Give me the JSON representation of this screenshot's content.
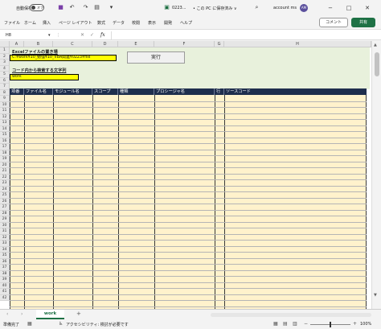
{
  "titlebar": {
    "autosave_label": "自動保存",
    "autosave_state": "オフ",
    "doc_name": "0223...",
    "save_status": "• この PC に保存済み ∨",
    "account_name": "account ms",
    "avatar_initials": "AM"
  },
  "menu": {
    "items": [
      "ファイル",
      "ホーム",
      "挿入",
      "ページ レイアウト",
      "数式",
      "データ",
      "校閲",
      "表示",
      "開発",
      "ヘルプ"
    ],
    "comment_label": "コメント",
    "share_label": "共有"
  },
  "formula_bar": {
    "name_box": "H8",
    "fx_label": "fx",
    "value": ""
  },
  "grid": {
    "columns": [
      "A",
      "B",
      "C",
      "D",
      "E",
      "F",
      "G",
      "H"
    ],
    "rows": [
      "1",
      "2",
      "3",
      "4",
      "5",
      "6",
      "7",
      "8",
      "9",
      "10",
      "11",
      "12",
      "13",
      "14",
      "15",
      "16",
      "17",
      "18",
      "19",
      "20",
      "21",
      "22",
      "23",
      "24",
      "25",
      "26",
      "27",
      "28",
      "29",
      "30",
      "31",
      "32",
      "33",
      "34",
      "35",
      "36",
      "37",
      "38",
      "39",
      "40",
      "41",
      "42"
    ]
  },
  "form": {
    "path_label": "Excelファイルの置き場",
    "path_value": "C:¥work¥10_勉強¥10_VBA関連¥0223¥file",
    "run_button": "実行",
    "search_label": "コード内から検索する文字列",
    "search_value": "work"
  },
  "result_table": {
    "headers": [
      "項番",
      "ファイル名",
      "モジュール名",
      "スコープ",
      "種類",
      "プロシージャ名",
      "行",
      "ソースコード"
    ]
  },
  "sheet_tabs": {
    "active": "work",
    "add_label": "+"
  },
  "statusbar": {
    "ready": "準備完了",
    "accessibility": "アクセシビリティ: 検討が必要です",
    "zoom_level": "100%"
  },
  "colors": {
    "accent": "#1e7145",
    "top_area_bg": "#e8f1dc",
    "input_bg": "#ffff00",
    "header_bg": "#1f2e4d",
    "table_bg": "#fff2cc"
  }
}
